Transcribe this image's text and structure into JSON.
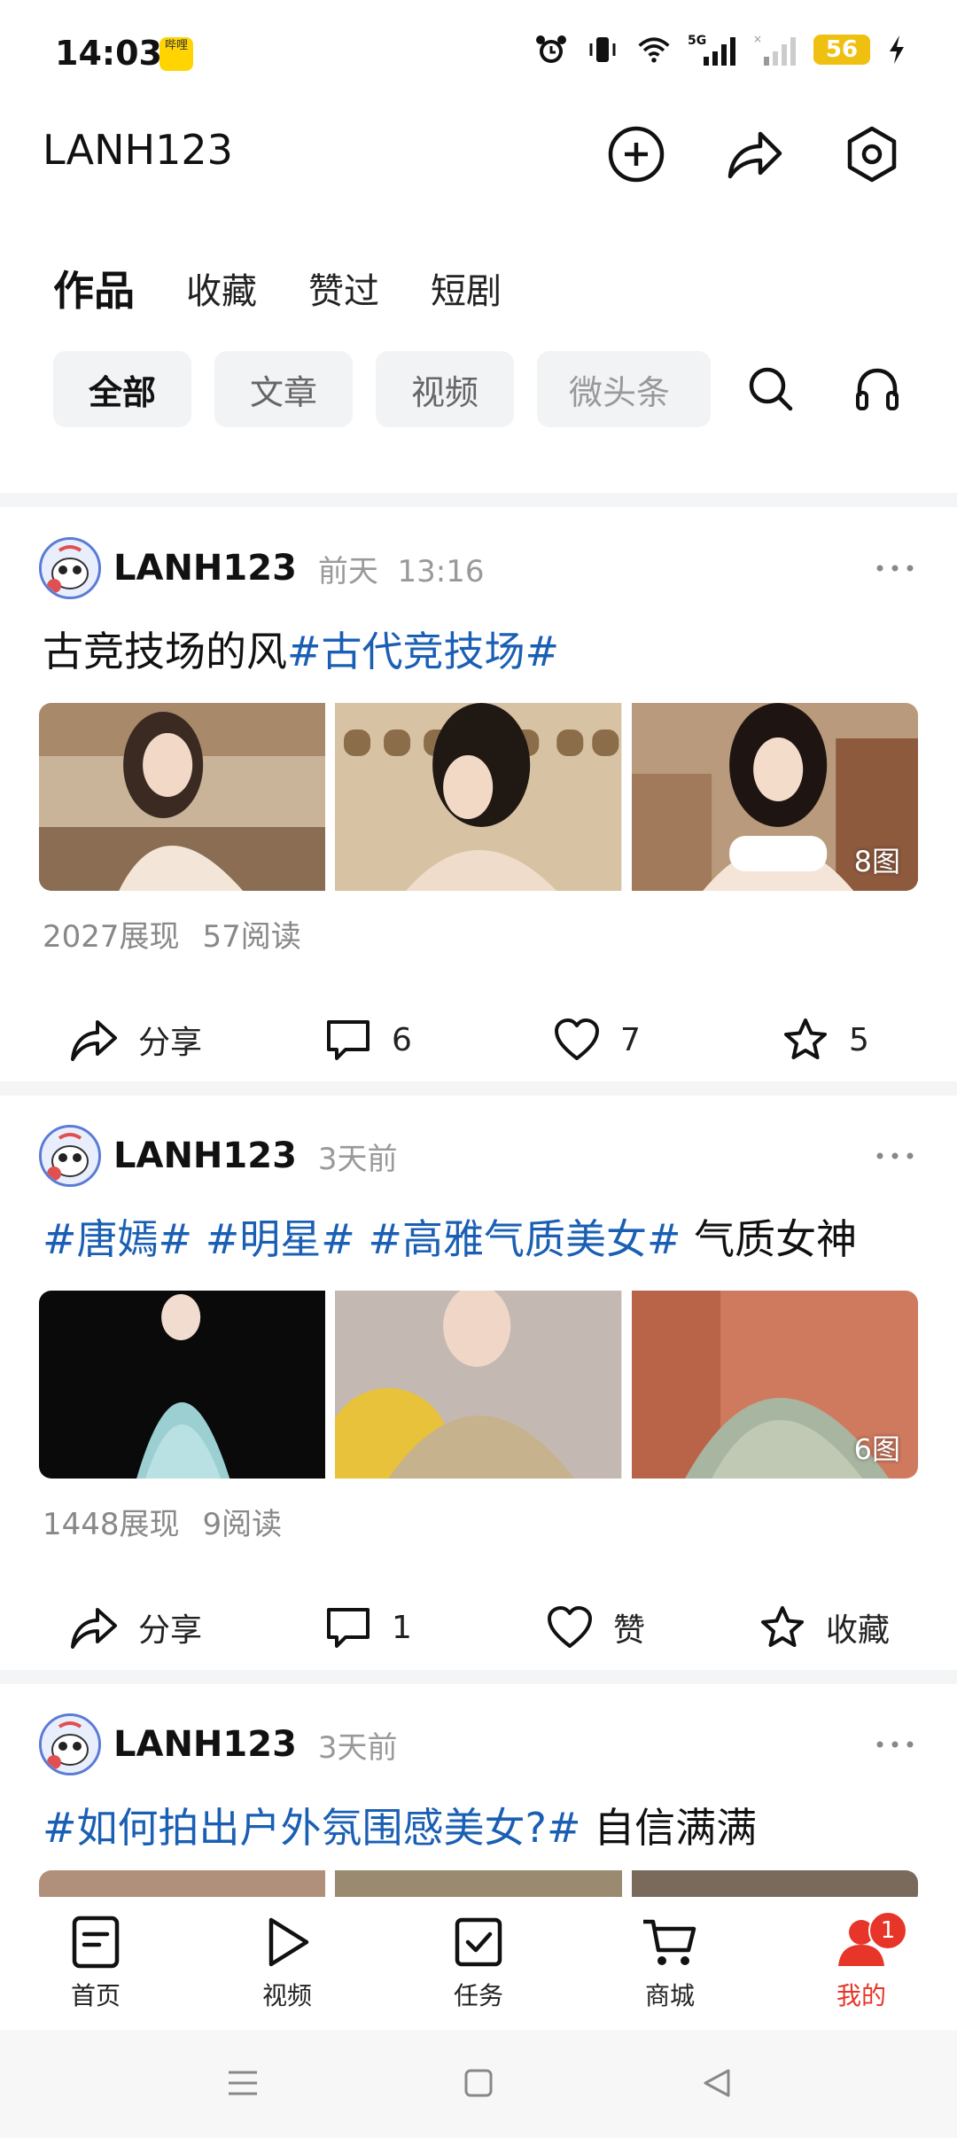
{
  "status_bar": {
    "time": "14:03",
    "app_badge": "哔哩",
    "network": "5G",
    "battery": "56"
  },
  "header": {
    "title": "LANH123"
  },
  "tabs": [
    "作品",
    "收藏",
    "赞过",
    "短剧"
  ],
  "filters": [
    "全部",
    "文章",
    "视频",
    "微头条"
  ],
  "posts": [
    {
      "user": "LANH123",
      "time": "前天",
      "time_detail": "13:16",
      "title_plain": "古竞技场的风",
      "title_tag": "#古代竞技场#",
      "image_count": "8图",
      "views": "2027展现",
      "reads": "57阅读",
      "share": "分享",
      "comments": "6",
      "likes": "7",
      "favorites": "5"
    },
    {
      "user": "LANH123",
      "time": "3天前",
      "title_tags": "#唐嫣# #明星# #高雅气质美女#",
      "title_plain": " 气质女神",
      "image_count": "6图",
      "views": "1448展现",
      "reads": "9阅读",
      "share": "分享",
      "comments": "1",
      "likes": "赞",
      "favorites": "收藏"
    },
    {
      "user": "LANH123",
      "time": "3天前",
      "title_tag": "#如何拍出户外氛围感美女?#",
      "title_plain": " 自信满满"
    }
  ],
  "bottom_nav": [
    {
      "label": "首页",
      "icon": "home-doc-icon"
    },
    {
      "label": "视频",
      "icon": "play-icon"
    },
    {
      "label": "任务",
      "icon": "task-check-icon"
    },
    {
      "label": "商城",
      "icon": "cart-icon"
    },
    {
      "label": "我的",
      "icon": "profile-icon",
      "badge": "1"
    }
  ],
  "colors": {
    "accent": "#e8352a",
    "hashtag": "#1a5fb4",
    "chip_bg": "#f2f3f5"
  }
}
